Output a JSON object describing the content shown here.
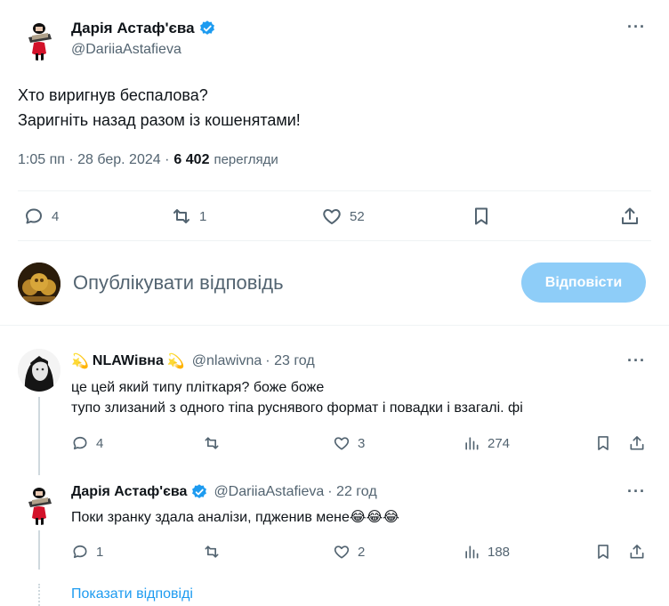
{
  "main_tweet": {
    "author_name": "Дарія Астаф'єва",
    "author_handle": "@DariiaAstafieva",
    "text_line1": "Хто виригнув беспалова?",
    "text_line2": "Заригніть назад разом із кошенятами!",
    "time": "1:05 пп · 28 бер. 2024 ·",
    "views_count": "6 402",
    "views_label": "перегляди",
    "replies": "4",
    "reposts": "1",
    "likes": "52"
  },
  "composer": {
    "placeholder": "Опублікувати відповідь",
    "reply_button": "Відповісти"
  },
  "replies": [
    {
      "name_emoji_left": "💫",
      "author_name": "NLAWівна",
      "name_emoji_right": "💫",
      "author_handle": "@nlawivna",
      "time": "· 23 год",
      "text_line1": "це цей який типу пліткаря? боже боже",
      "text_line2": "тупо злизаний з одного тіпа руснявого формат і повадки і взагалі. фі",
      "replies": "4",
      "reposts": "",
      "likes": "3",
      "views": "274"
    },
    {
      "author_name": "Дарія Астаф'єва",
      "author_handle": "@DariiaAstafieva",
      "time": "· 22 год",
      "text": "Поки зранку здала аналізи, пдженив мене😂😂😂",
      "replies": "1",
      "reposts": "",
      "likes": "2",
      "views": "188"
    }
  ],
  "show_replies_link": "Показати відповіді",
  "colors": {
    "accent": "#1d9bf0",
    "reply_button_bg": "#8ecdf8",
    "muted": "#536471"
  }
}
